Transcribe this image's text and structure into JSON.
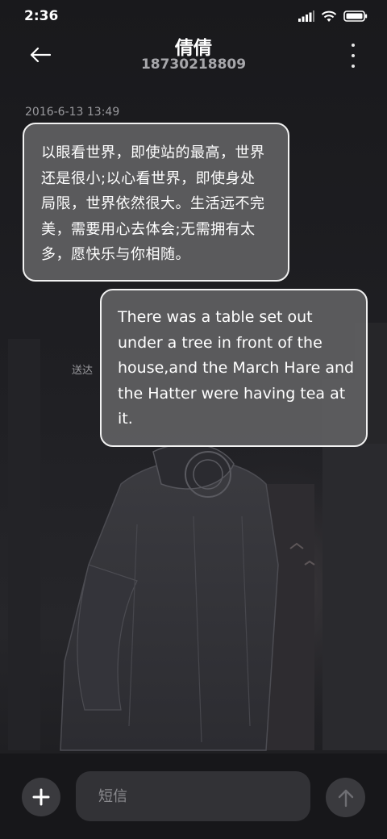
{
  "status_bar": {
    "time": "2:36",
    "icons": [
      "signal-icon",
      "wifi-icon",
      "battery-icon"
    ]
  },
  "header": {
    "contact_name": "倩倩",
    "phone_number": "18730218809",
    "back_icon": "back-arrow-icon",
    "more_icon": "more-vertical-icon"
  },
  "messages": [
    {
      "direction": "incoming",
      "timestamp": "2016-6-13 13:49",
      "lines": [
        "以眼看世界，即使站的最高，世界",
        "还是很小;以心看世界，即使身处",
        "局限，世界依然很大。生活远不完",
        "美，需要用心去体会;无需拥有太",
        "多，愿快乐与你相随。"
      ]
    },
    {
      "direction": "outgoing",
      "status": "送达",
      "lines": [
        "There was a table set out",
        "under a tree in front of the",
        "house,and the March Hare and",
        "the Hatter were having tea at",
        "it."
      ]
    }
  ],
  "composer": {
    "placeholder": "短信",
    "value": "",
    "add_icon": "plus-icon",
    "send_icon": "send-arrow-up-icon"
  },
  "colors": {
    "bubble_fill": "#606062",
    "bubble_border": "#f2f2f2",
    "text_primary": "#ffffff",
    "text_secondary": "#9a9a9e",
    "bottom_bar": "#17171a",
    "button_fill": "#3a3a3e",
    "input_fill": "#323236"
  }
}
